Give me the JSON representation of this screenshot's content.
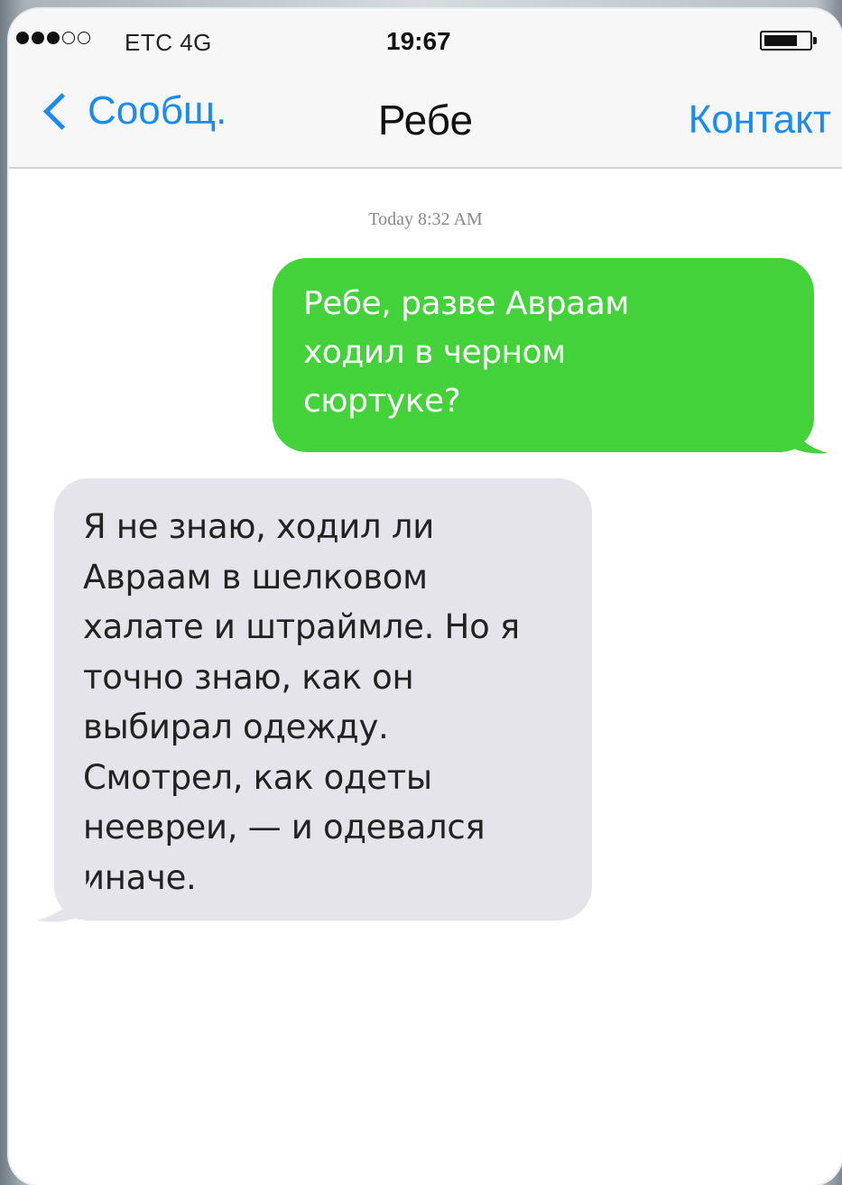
{
  "status_bar": {
    "carrier": "ETC  4G",
    "time": "19:67",
    "signal_bars_filled": 3,
    "signal_bars_total": 5,
    "battery_level": 0.7
  },
  "nav": {
    "back_label": "Сообщ.",
    "title": "Ребе",
    "contact_label": "Контакт"
  },
  "conversation": {
    "timestamp": "Today  8:32  AM",
    "messages": [
      {
        "direction": "outgoing",
        "lines": [
          "Ребе, разве Авраам",
          "ходил в черном",
          "сюртуке?"
        ]
      },
      {
        "direction": "incoming",
        "lines": [
          "Я не знаю, ходил ли",
          "Авраам в шелковом",
          "халате и штраймле. Но я",
          "точно знаю, как он",
          "выбирал одежду.",
          "Смотрел, как одеты",
          "неевреи, — и одевался",
          "иначе."
        ]
      }
    ]
  },
  "colors": {
    "accent": "#1a8cf0",
    "outgoing_bubble": "#43d23a",
    "incoming_bubble": "#e4e4ea"
  }
}
